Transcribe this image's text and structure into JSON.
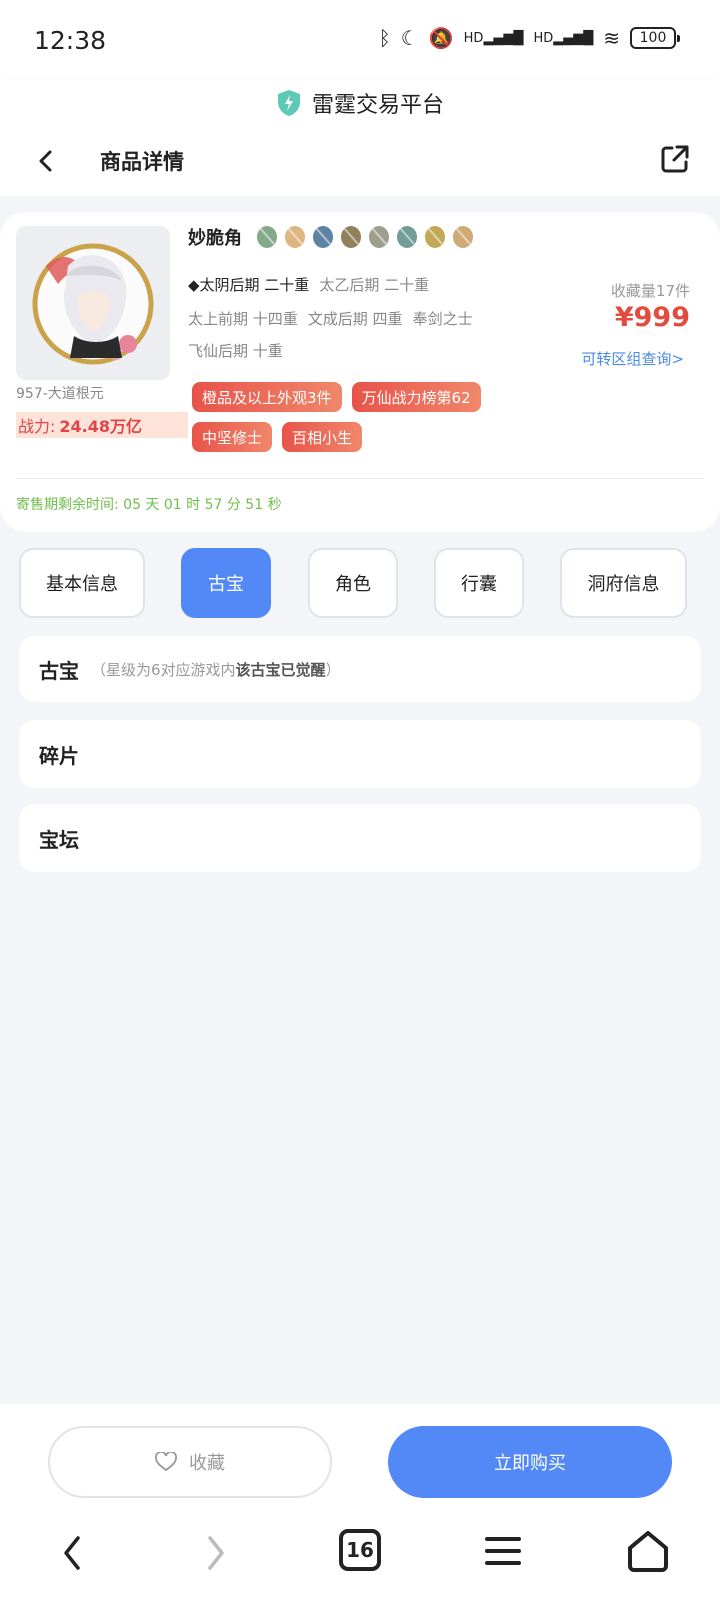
{
  "status_bar": {
    "time": "12:38",
    "battery": "100",
    "hd1": "HD",
    "hd2": "HD"
  },
  "browser": {
    "title": "雷霆交易平台"
  },
  "nav": {
    "title": "商品详情"
  },
  "product": {
    "name": "妙脆角",
    "server": "957-大道根元",
    "power_label": "战力:",
    "power_value": "24.48万亿",
    "realm_1_strong": "◆太阴后期 二十重",
    "realm_1_rest": "太乙后期 二十重",
    "realm_2a": "太上前期 十四重",
    "realm_2b": "文成后期 四重",
    "realm_2c": "奉剑之士",
    "realm_3": "飞仙后期 十重",
    "favorite_count": "收藏量17件",
    "price": "¥999",
    "transfer_link": "可转区组查询>",
    "tags": [
      "橙品及以上外观3件",
      "万仙战力榜第62",
      "中坚修士",
      "百相小生"
    ],
    "countdown": "寄售期剩余时间: 05 天 01 时 57 分 51 秒",
    "treasure_colors": [
      "#6f9a74",
      "#d8a96a",
      "#3f6e8f",
      "#7c6a3e",
      "#8d8d7a",
      "#5a8a86",
      "#b79a3a",
      "#c79b5e"
    ]
  },
  "tabs": [
    "基本信息",
    "古宝",
    "角色",
    "行囊",
    "洞府信息"
  ],
  "active_tab": "古宝",
  "sections": {
    "gubao_title": "古宝",
    "gubao_note_start": "（星级为6对应游戏内",
    "gubao_note_bold": "该古宝已觉醒",
    "gubao_note_end": "）",
    "fragments_title": "碎片",
    "altar_title": "宝坛"
  },
  "bottom": {
    "favorite_label": "收藏",
    "buy_label": "立即购买"
  },
  "sys_nav": {
    "tab_count": "16"
  },
  "colors": {
    "accent": "#5289f6",
    "price": "#e34b3c",
    "tag": "#e8534a",
    "countdown": "#6fbf4c"
  }
}
